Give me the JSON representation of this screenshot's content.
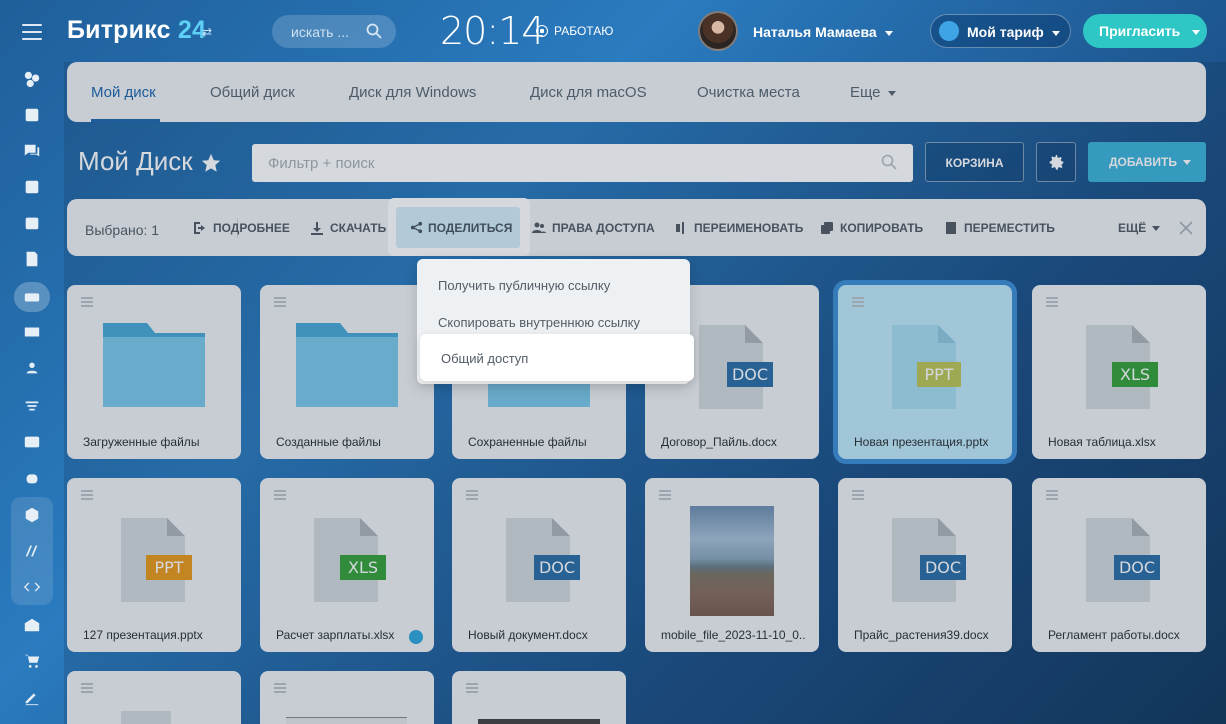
{
  "header": {
    "logo_text": "Битрикс",
    "logo_num": "24",
    "search_placeholder": "искать ...",
    "clock": "20:14",
    "status": "РАБОТАЮ",
    "user_name": "Наталья Мамаева",
    "tariff": "Мой тариф",
    "invite": "Пригласить"
  },
  "tabs": [
    {
      "label": "Мой диск",
      "active": true
    },
    {
      "label": "Общий диск"
    },
    {
      "label": "Диск для Windows"
    },
    {
      "label": "Диск для macOS"
    },
    {
      "label": "Очистка места"
    },
    {
      "label": "Еще"
    }
  ],
  "page": {
    "title": "Мой Диск",
    "filter_placeholder": "Фильтр + поиск",
    "trash": "КОРЗИНА",
    "add": "ДОБАВИТЬ"
  },
  "toolbar": {
    "selected": "Выбрано: 1",
    "details": "ПОДРОБНЕЕ",
    "download": "СКАЧАТЬ",
    "share": "ПОДЕЛИТЬСЯ",
    "access": "ПРАВА ДОСТУПА",
    "rename": "ПЕРЕИМЕНОВАТЬ",
    "copy": "КОПИРОВАТЬ",
    "move": "ПЕРЕМЕСТИТЬ",
    "more": "ЕЩЁ"
  },
  "share_menu": {
    "public_link": "Получить публичную ссылку",
    "internal_link": "Скопировать внутреннюю ссылку",
    "shared_access": "Общий доступ"
  },
  "files": [
    {
      "name": "Загруженные файлы",
      "type": "folder"
    },
    {
      "name": "Созданные файлы",
      "type": "folder"
    },
    {
      "name": "Сохраненные файлы",
      "type": "folder"
    },
    {
      "name": "Договор_Пайль.docx",
      "type": "DOC"
    },
    {
      "name": "Новая презентация.pptx",
      "type": "PPT",
      "selected": true
    },
    {
      "name": "Новая таблица.xlsx",
      "type": "XLS"
    },
    {
      "name": "127 презентация.pptx",
      "type": "PPT"
    },
    {
      "name": "Расчет зарплаты.xlsx",
      "type": "XLS"
    },
    {
      "name": "Новый документ.docx",
      "type": "DOC"
    },
    {
      "name": "mobile_file_2023-11-10_0...",
      "type": "image"
    },
    {
      "name": "Прайс_растения39.docx",
      "type": "DOC"
    },
    {
      "name": "Регламент работы.docx",
      "type": "DOC"
    }
  ],
  "colors": {
    "doc": "#2d6ea8",
    "ppt_orange": "#e89a1c",
    "ppt_selected": "#bdc65a",
    "xls": "#36a33b",
    "accent": "#2067b0"
  }
}
